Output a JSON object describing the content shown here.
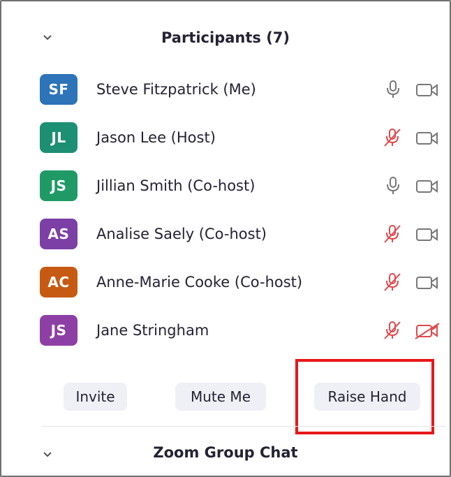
{
  "participants_panel": {
    "title": "Participants (7)",
    "participants": [
      {
        "initials": "SF",
        "name": "Steve Fitzpatrick (Me)",
        "avatar_color": "#2d74b8",
        "mic": "on",
        "video": "on"
      },
      {
        "initials": "JL",
        "name": "Jason Lee (Host)",
        "avatar_color": "#1d8f73",
        "mic": "muted",
        "video": "on"
      },
      {
        "initials": "JS",
        "name": "Jillian Smith (Co-host)",
        "avatar_color": "#1f9a66",
        "mic": "on",
        "video": "on"
      },
      {
        "initials": "AS",
        "name": "Analise Saely (Co-host)",
        "avatar_color": "#7b3fa6",
        "mic": "muted",
        "video": "on"
      },
      {
        "initials": "AC",
        "name": "Anne-Marie Cooke (Co-host)",
        "avatar_color": "#c65a12",
        "mic": "muted",
        "video": "on"
      },
      {
        "initials": "JS",
        "name": "Jane Stringham",
        "avatar_color": "#8e3fa6",
        "mic": "muted",
        "video": "off"
      }
    ],
    "buttons": {
      "invite": "Invite",
      "mute_me": "Mute Me",
      "raise_hand": "Raise Hand"
    }
  },
  "group_chat": {
    "title": "Zoom Group Chat"
  },
  "colors": {
    "muted_red": "#e0484b",
    "icon_gray": "#777777",
    "highlight_red": "#e8171b"
  }
}
